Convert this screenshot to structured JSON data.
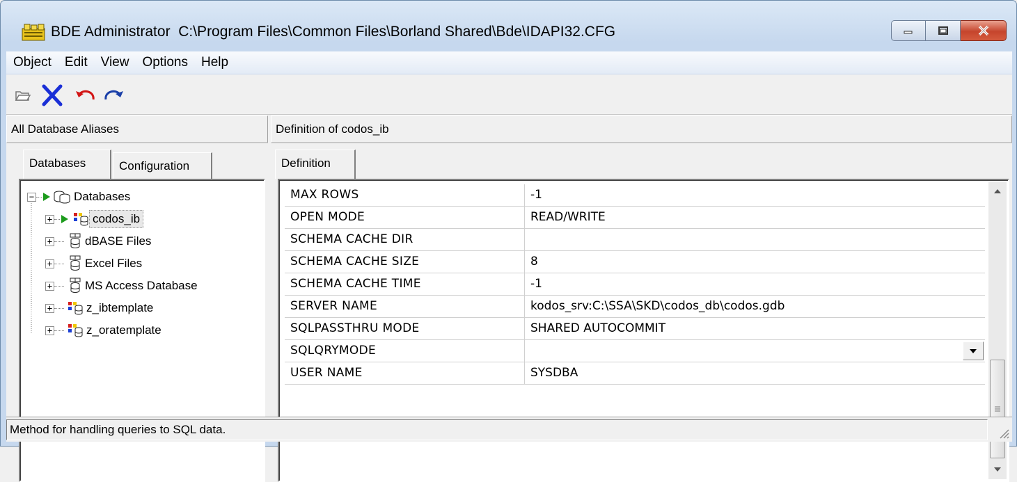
{
  "window": {
    "title": "BDE Administrator  C:\\Program Files\\Common Files\\Borland Shared\\Bde\\IDAPI32.CFG",
    "icon": "bde-app-icon",
    "minimize_icon": "minimize-icon",
    "maximize_icon": "maximize-icon",
    "close_icon": "close-icon",
    "close_color": "#c6452c"
  },
  "menu": [
    {
      "label": "Object"
    },
    {
      "label": "Edit"
    },
    {
      "label": "View"
    },
    {
      "label": "Options"
    },
    {
      "label": "Help"
    }
  ],
  "toolbar": {
    "open_icon": "open-folder-icon",
    "delete_icon": "delete-x-icon",
    "undo_icon": "undo-icon",
    "apply_icon": "redo-apply-icon",
    "delete_color": "#1a2fd6",
    "undo_color": "#d21414"
  },
  "left": {
    "header": "All Database Aliases",
    "tabs": [
      {
        "label": "Databases"
      },
      {
        "label": "Configuration"
      }
    ],
    "tree": [
      {
        "label": "Databases"
      },
      {
        "label": "codos_ib"
      },
      {
        "label": "dBASE Files"
      },
      {
        "label": "Excel Files"
      },
      {
        "label": "MS Access Database"
      },
      {
        "label": "z_ibtemplate"
      },
      {
        "label": "z_oratemplate"
      }
    ]
  },
  "right": {
    "header": "Definition of codos_ib",
    "tab": "Definition",
    "rows": [
      {
        "key": "MAX ROWS",
        "value": "-1"
      },
      {
        "key": "OPEN MODE",
        "value": "READ/WRITE"
      },
      {
        "key": "SCHEMA CACHE DIR",
        "value": ""
      },
      {
        "key": "SCHEMA CACHE SIZE",
        "value": "8"
      },
      {
        "key": "SCHEMA CACHE TIME",
        "value": "-1"
      },
      {
        "key": "SERVER NAME",
        "value": "kodos_srv:C:\\SSA\\SKD\\codos_db\\codos.gdb"
      },
      {
        "key": "SQLPASSTHRU MODE",
        "value": "SHARED AUTOCOMMIT"
      },
      {
        "key": "SQLQRYMODE",
        "value": ""
      },
      {
        "key": "USER NAME",
        "value": "SYSDBA"
      }
    ]
  },
  "status": {
    "text": "Method for handling queries to SQL data."
  }
}
